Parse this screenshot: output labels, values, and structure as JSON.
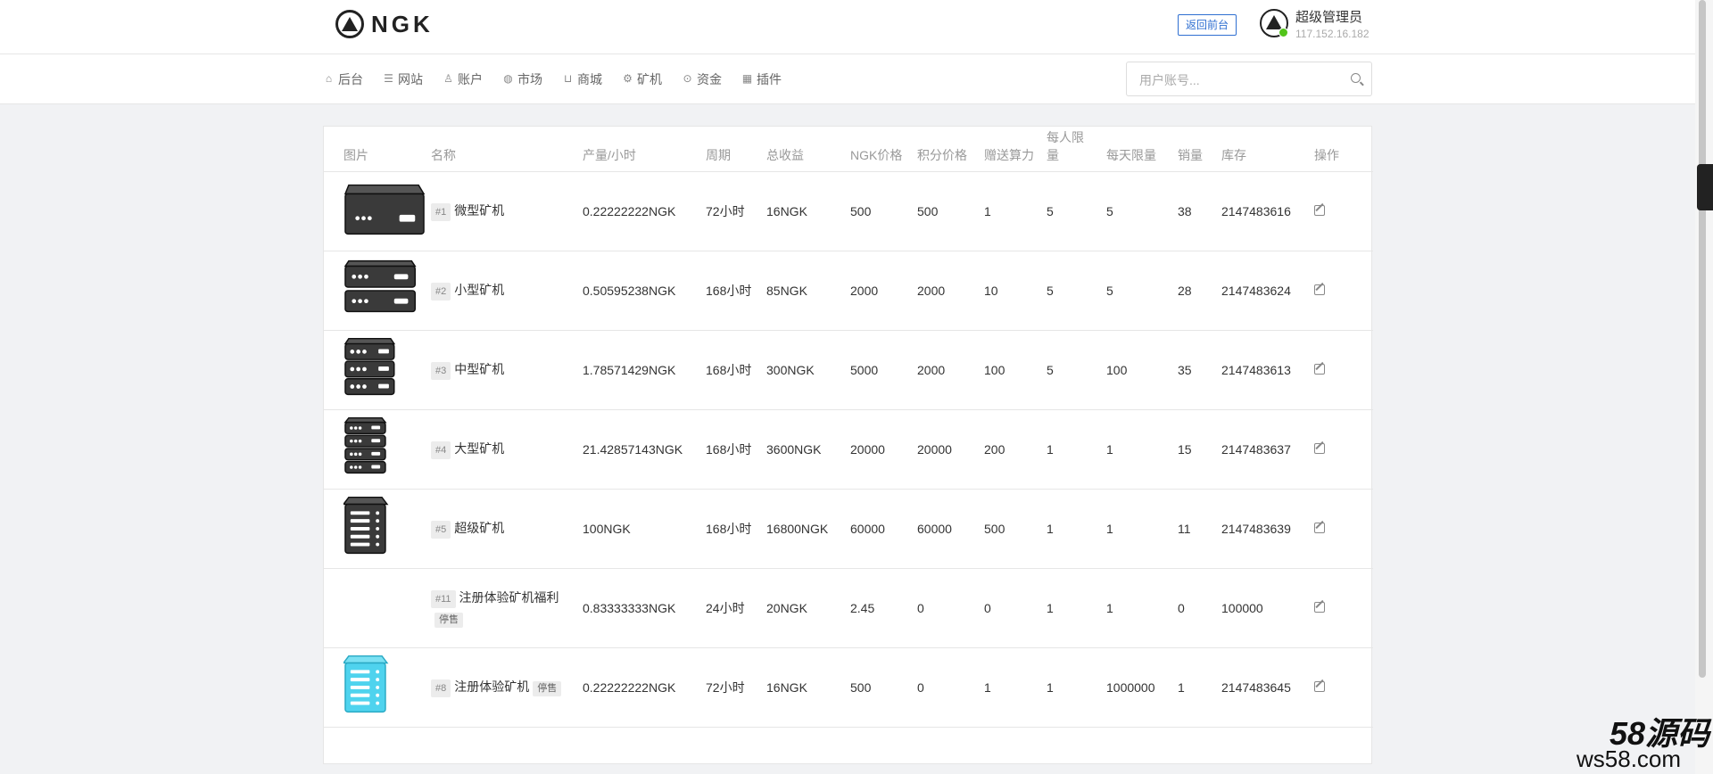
{
  "brand": {
    "name": "NGK"
  },
  "header": {
    "back_label": "返回前台",
    "admin_name": "超级管理员",
    "admin_ip": "117.152.16.182"
  },
  "nav": [
    {
      "label": "后台",
      "icon": "home-icon"
    },
    {
      "label": "网站",
      "icon": "list-icon"
    },
    {
      "label": "账户",
      "icon": "users-icon"
    },
    {
      "label": "市场",
      "icon": "globe-icon"
    },
    {
      "label": "商城",
      "icon": "cart-icon"
    },
    {
      "label": "矿机",
      "icon": "chip-icon"
    },
    {
      "label": "资金",
      "icon": "coin-icon"
    },
    {
      "label": "插件",
      "icon": "grid-icon"
    }
  ],
  "search": {
    "placeholder": "用户账号..."
  },
  "table": {
    "columns": [
      "图片",
      "名称",
      "产量/小时",
      "周期",
      "总收益",
      "NGK价格",
      "积分价格",
      "赠送算力",
      "每人限量",
      "每天限量",
      "销量",
      "库存",
      "操作"
    ],
    "rows": [
      {
        "id": "#1",
        "name": "微型矿机",
        "status": "",
        "output": "0.22222222NGK",
        "cycle": "72小时",
        "total": "16NGK",
        "ngk_price": "500",
        "point_price": "500",
        "power": "1",
        "per_user": "5",
        "per_day": "5",
        "sales": "38",
        "stock": "2147483616",
        "image": "micro"
      },
      {
        "id": "#2",
        "name": "小型矿机",
        "status": "",
        "output": "0.50595238NGK",
        "cycle": "168小时",
        "total": "85NGK",
        "ngk_price": "2000",
        "point_price": "2000",
        "power": "10",
        "per_user": "5",
        "per_day": "5",
        "sales": "28",
        "stock": "2147483624",
        "image": "small"
      },
      {
        "id": "#3",
        "name": "中型矿机",
        "status": "",
        "output": "1.78571429NGK",
        "cycle": "168小时",
        "total": "300NGK",
        "ngk_price": "5000",
        "point_price": "2000",
        "power": "100",
        "per_user": "5",
        "per_day": "100",
        "sales": "35",
        "stock": "2147483613",
        "image": "medium"
      },
      {
        "id": "#4",
        "name": "大型矿机",
        "status": "",
        "output": "21.42857143NGK",
        "cycle": "168小时",
        "total": "3600NGK",
        "ngk_price": "20000",
        "point_price": "20000",
        "power": "200",
        "per_user": "1",
        "per_day": "1",
        "sales": "15",
        "stock": "2147483637",
        "image": "large"
      },
      {
        "id": "#5",
        "name": "超级矿机",
        "status": "",
        "output": "100NGK",
        "cycle": "168小时",
        "total": "16800NGK",
        "ngk_price": "60000",
        "point_price": "60000",
        "power": "500",
        "per_user": "1",
        "per_day": "1",
        "sales": "11",
        "stock": "2147483639",
        "image": "super"
      },
      {
        "id": "#11",
        "name": "注册体验矿机福利",
        "status": "停售",
        "output": "0.83333333NGK",
        "cycle": "24小时",
        "total": "20NGK",
        "ngk_price": "2.45",
        "point_price": "0",
        "power": "0",
        "per_user": "1",
        "per_day": "1",
        "sales": "0",
        "stock": "100000",
        "image": "none"
      },
      {
        "id": "#8",
        "name": "注册体验矿机",
        "status": "停售",
        "output": "0.22222222NGK",
        "cycle": "72小时",
        "total": "16NGK",
        "ngk_price": "500",
        "point_price": "0",
        "power": "1",
        "per_user": "1",
        "per_day": "1000000",
        "sales": "1",
        "stock": "2147483645",
        "image": "cyan"
      }
    ]
  },
  "watermark": {
    "line1": "58源码",
    "line2": "ws58.com"
  },
  "colors": {
    "accent": "#2f6fd1",
    "online": "#52c41a",
    "machine_dark": "#3a3a3a",
    "machine_cyan": "#4fd3ee"
  }
}
